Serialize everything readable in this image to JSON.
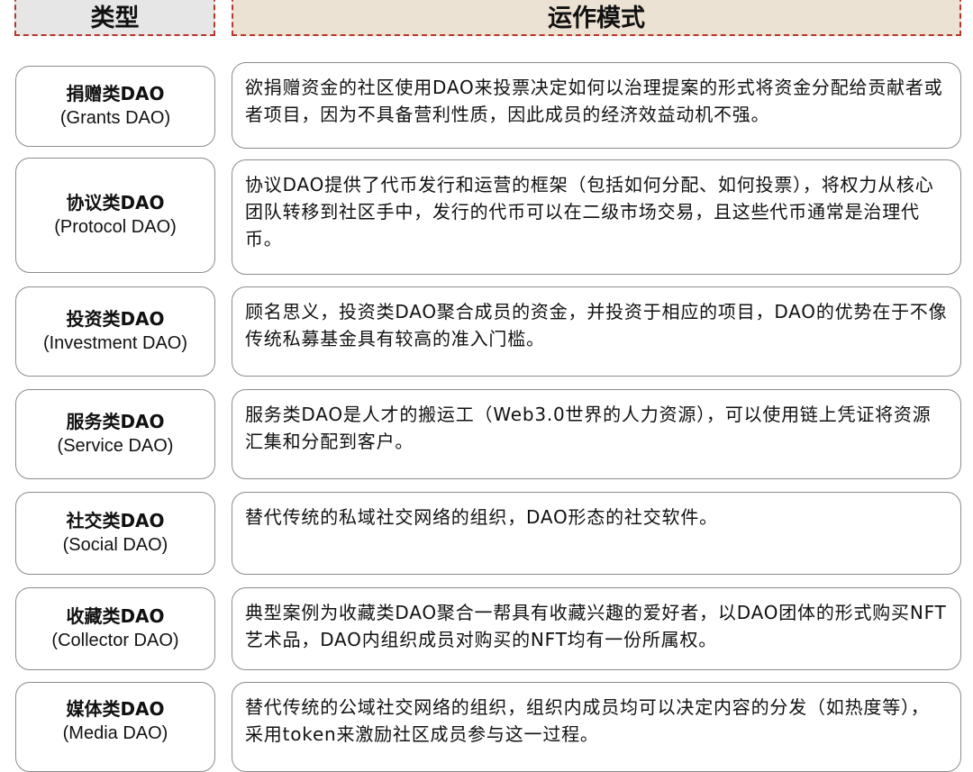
{
  "header": {
    "type_label": "类型",
    "mode_label": "运作模式"
  },
  "rows": [
    {
      "type_cn": "捐赠类DAO",
      "type_en": "(Grants DAO)",
      "description": "欲捐赠资金的社区使用DAO来投票决定如何以治理提案的形式将资金分配给贡献者或者项目，因为不具备营利性质，因此成员的经济效益动机不强。"
    },
    {
      "type_cn": "协议类DAO",
      "type_en": "(Protocol DAO)",
      "description": "协议DAO提供了代币发行和运营的框架（包括如何分配、如何投票），将权力从核心团队转移到社区手中，发行的代币可以在二级市场交易，且这些代币通常是治理代币。"
    },
    {
      "type_cn": "投资类DAO",
      "type_en": "(Investment  DAO)",
      "description": "顾名思义，投资类DAO聚合成员的资金，并投资于相应的项目，DAO的优势在于不像传统私募基金具有较高的准入门槛。"
    },
    {
      "type_cn": "服务类DAO",
      "type_en": "(Service  DAO)",
      "description": "服务类DAO是人才的搬运工（Web3.0世界的人力资源），可以使用链上凭证将资源汇集和分配到客户。"
    },
    {
      "type_cn": "社交类DAO",
      "type_en": "(Social  DAO)",
      "description": "替代传统的私域社交网络的组织，DAO形态的社交软件。"
    },
    {
      "type_cn": "收藏类DAO",
      "type_en": "(Collector  DAO)",
      "description": "典型案例为收藏类DAO聚合一帮具有收藏兴趣的爱好者，以DAO团体的形式购买NFT艺术品，DAO内组织成员对购买的NFT均有一份所属权。"
    },
    {
      "type_cn": "媒体类DAO",
      "type_en": "(Media DAO)",
      "description": "替代传统的公域社交网络的组织，组织内成员均可以决定内容的分发（如热度等），采用token来激励社区成员参与这一过程。"
    }
  ]
}
